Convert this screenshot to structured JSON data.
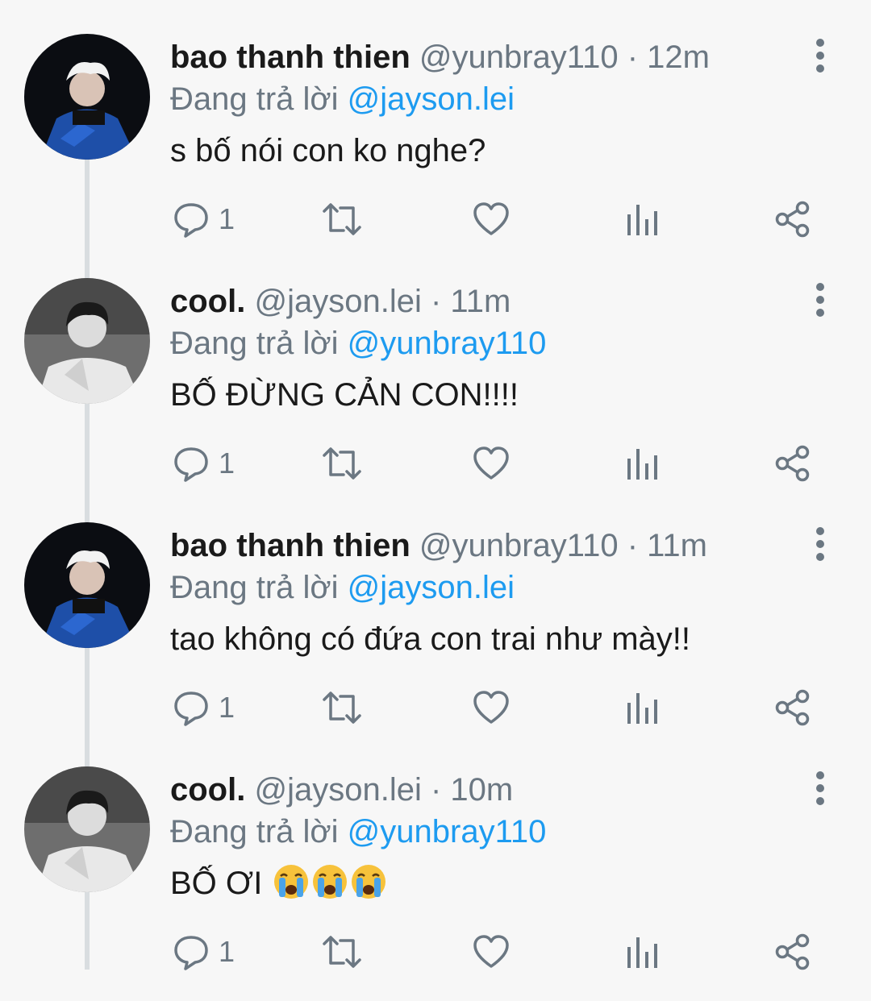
{
  "tweets": [
    {
      "name": "bao thanh thien",
      "handle": "@yunbray110",
      "separator": "·",
      "time": "12m",
      "reply_prefix": "Đang trả lời",
      "reply_to": "@jayson.lei",
      "text": "s bố nói con ko nghe?",
      "reply_count": "1",
      "avatar": "blue-suit-avatar"
    },
    {
      "name": "cool.",
      "handle": "@jayson.lei",
      "separator": "·",
      "time": "11m",
      "reply_prefix": "Đang trả lời",
      "reply_to": "@yunbray110",
      "text": "BỐ ĐỪNG CẢN CON!!!!",
      "reply_count": "1",
      "avatar": "bw-portrait-avatar"
    },
    {
      "name": "bao thanh thien",
      "handle": "@yunbray110",
      "separator": "·",
      "time": "11m",
      "reply_prefix": "Đang trả lời",
      "reply_to": "@jayson.lei",
      "text": "tao không có đứa con trai như mày!!",
      "reply_count": "1",
      "avatar": "blue-suit-avatar"
    },
    {
      "name": "cool.",
      "handle": "@jayson.lei",
      "separator": "·",
      "time": "10m",
      "reply_prefix": "Đang trả lời",
      "reply_to": "@yunbray110",
      "text": "BỐ ƠI",
      "text_emoji": [
        "crying-face-emoji",
        "crying-face-emoji",
        "crying-face-emoji"
      ],
      "reply_count": "1",
      "avatar": "bw-portrait-avatar"
    }
  ],
  "icons": {
    "reply": "reply-icon",
    "retweet": "retweet-icon",
    "like": "heart-icon",
    "stats": "analytics-icon",
    "share": "share-icon",
    "more": "more-vertical-icon"
  },
  "colors": {
    "background": "#f7f7f7",
    "mention": "#1d9bf0",
    "muted": "#6b7782",
    "thread_line": "#d9dde0"
  }
}
